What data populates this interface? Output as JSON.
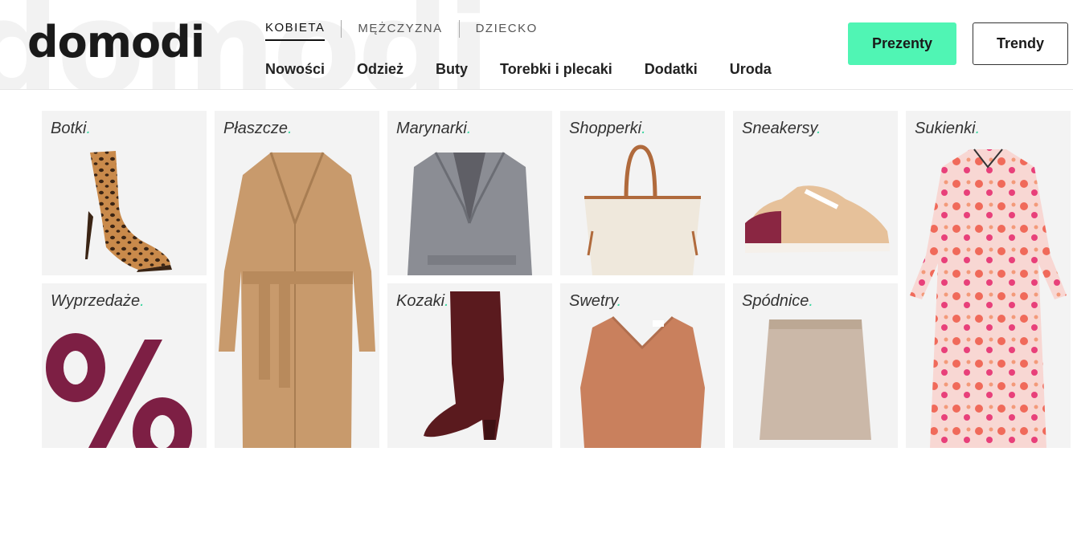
{
  "brand": {
    "logo_text": "domodi",
    "ghost_text": "domodi"
  },
  "gender_tabs": [
    {
      "label": "KOBIETA",
      "active": true
    },
    {
      "label": "MĘŻCZYZNA",
      "active": false
    },
    {
      "label": "DZIECKO",
      "active": false
    }
  ],
  "categories": [
    "Nowości",
    "Odzież",
    "Buty",
    "Torebki i plecaki",
    "Dodatki",
    "Uroda"
  ],
  "buttons": {
    "gifts": "Prezenty",
    "trends": "Trendy"
  },
  "colors": {
    "accent": "#50f5b4",
    "dot": "#3cd6a0",
    "tile_bg": "#f3f3f3"
  },
  "tiles": [
    {
      "label": "Botki",
      "icon": "leopard-boot-image"
    },
    {
      "label": "Płaszcze",
      "icon": "camel-coat-image"
    },
    {
      "label": "Marynarki",
      "icon": "blazer-image"
    },
    {
      "label": "Shopperki",
      "icon": "shopper-bag-image"
    },
    {
      "label": "Sneakersy",
      "icon": "sneaker-image"
    },
    {
      "label": "Sukienki",
      "icon": "floral-dress-image"
    },
    {
      "label": "Wyprzedaże",
      "icon": "percent-icon"
    },
    {
      "label": "Kozaki",
      "icon": "knee-boot-image"
    },
    {
      "label": "Swetry",
      "icon": "sweater-image"
    },
    {
      "label": "Spódnice",
      "icon": "skirt-image"
    }
  ]
}
